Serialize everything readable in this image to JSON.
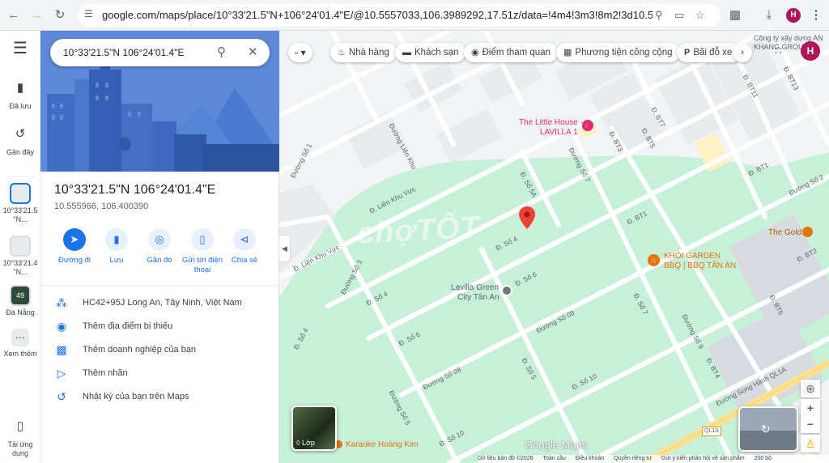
{
  "browser": {
    "url": "google.com/maps/place/10°33'21.5\"N+106°24'01.4\"E/@10.5557033,106.3989292,17.51z/data=!4m4!3m3!8m2!3d10.555966!4d106.40...",
    "profile_initial": "H"
  },
  "rail": {
    "saved": "Đã lưu",
    "recent": "Gần đây",
    "recent_item_1": "10°33'21.5 \"N...",
    "recent_item_2": "10°33'21.4 \"N...",
    "danang_badge": "49",
    "danang": "Đà Nẵng",
    "more": "Xem thêm",
    "download": "Tải ứng dụng"
  },
  "search": {
    "query": "10°33'21.5\"N 106°24'01.4\"E"
  },
  "place": {
    "title": "10°33'21.5\"N 106°24'01.4\"E",
    "decimal": "10.555966, 106.400390"
  },
  "actions": [
    {
      "label": "Đường đi",
      "icon": "directions-icon"
    },
    {
      "label": "Lưu",
      "icon": "bookmark-icon"
    },
    {
      "label": "Gần đó",
      "icon": "nearby-icon"
    },
    {
      "label": "Gửi tới điện thoại",
      "icon": "send-to-phone-icon"
    },
    {
      "label": "Chia sẻ",
      "icon": "share-icon"
    }
  ],
  "info_rows": [
    {
      "text": "HC42+95J Long An, Tây Ninh, Việt Nam",
      "icon": "plus-code-icon"
    },
    {
      "text": "Thêm địa điểm bị thiếu",
      "icon": "add-place-icon"
    },
    {
      "text": "Thêm doanh nghiệp của bạn",
      "icon": "add-business-icon"
    },
    {
      "text": "Thêm nhãn",
      "icon": "label-icon"
    },
    {
      "text": "Nhật ký của bạn trên Maps",
      "icon": "history-icon"
    }
  ],
  "chips": [
    {
      "label": "Nhà hàng",
      "icon": "restaurant-icon"
    },
    {
      "label": "Khách sạn",
      "icon": "hotel-icon"
    },
    {
      "label": "Điểm tham quan",
      "icon": "camera-icon"
    },
    {
      "label": "Phương tiện công cộng",
      "icon": "transit-icon"
    },
    {
      "label": "Bãi đỗ xe",
      "icon": "parking-icon"
    }
  ],
  "map_labels": {
    "little_house_1": "The Little House -",
    "little_house_2": "LAVILLA 1",
    "the_gold": "The Gold",
    "khoi_garden_1": "KHÓI GARDEN",
    "khoi_garden_2": "BBQ | BBQ TÂN AN",
    "lavilla_green_1": "Lavilla Green",
    "lavilla_green_2": "City Tân An",
    "karaoke": "Karaoke Hoàng Kim",
    "company_1": "Công ty xây dựng AN",
    "company_2": "KHANG GROUP",
    "google_logo": "Google Maps",
    "watermark": "chợTỐT",
    "layers": "Lớp",
    "highway": "QL1A"
  },
  "streets": {
    "so1": "Đường Số 1",
    "lien_khu_1": "Đường Liên Khu",
    "lien_khu_vuc_1": "Đ. Liên Khu Vực",
    "lien_khu_vuc_2": "Đ. Liên Khu Vực",
    "so3": "Đường Số 3",
    "so5a": "Đ. Số 5A",
    "so7": "Đường Số 7",
    "bt3": "Đ. BT3",
    "bt5": "Đ. BT5",
    "bt7": "Đ. BT7",
    "bt11": "Đ. BT11",
    "bt13": "Đ. BT13",
    "bt1": "Đ. BT1",
    "bt1b": "Đ. BT1",
    "so4": "Đ. Số 4",
    "so4b": "Đ. Số 4",
    "so4c": "Đ. Số 4",
    "so6": "Đ. Số 6",
    "so6b": "Đ. Số 6",
    "so08": "Đường Số 08",
    "so08b": "Đường Số 08",
    "so10": "Đ. Số 10",
    "so10b": "Đ. Số 10",
    "so5": "Đ. Số 5",
    "so5b": "Đường Số 5",
    "so7b": "Đ. Số 7",
    "so9": "Đường Số 9",
    "so2": "Đường Số 2",
    "bt2": "Đ. BT2",
    "bt4": "Đ. BT4",
    "bt6": "Đ. BT6",
    "song_hanh": "Đường Song Hành QL1A"
  },
  "footer": {
    "data": "Dữ liệu bản đồ ©2026",
    "global": "Toàn cầu",
    "terms": "Điều khoản",
    "privacy": "Quyền riêng tư",
    "feedback": "Gửi ý kiến phản hồi về sản phẩm",
    "scale": "200 bộ"
  },
  "colors": {
    "accent": "#1a73e8",
    "park": "#c7f0d8",
    "road": "#ffffff",
    "pin": "#ea4335",
    "poi_pink": "#e5296f",
    "poi_orange": "#e8710a"
  }
}
